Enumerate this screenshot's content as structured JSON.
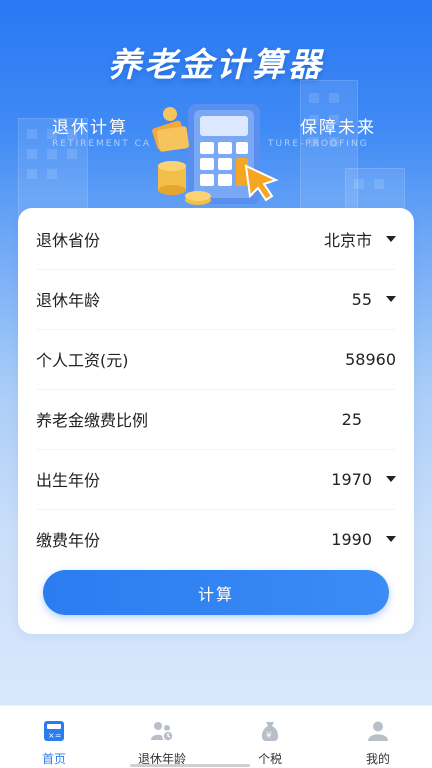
{
  "header": {
    "title": "养老金计算器",
    "sub_left": "退休计算",
    "sub_left_en": "RETIREMENT CA",
    "sub_right": "保障未来",
    "sub_right_en": "TURE-PROOFING"
  },
  "form": {
    "rows": [
      {
        "label": "退休省份",
        "value": "北京市",
        "dropdown": true
      },
      {
        "label": "退休年龄",
        "value": "55",
        "dropdown": true
      },
      {
        "label": "个人工资(元)",
        "value": "58960",
        "dropdown": false
      },
      {
        "label": "养老金缴费比例",
        "value": "25",
        "dropdown": false
      },
      {
        "label": "出生年份",
        "value": "1970",
        "dropdown": true
      },
      {
        "label": "缴费年份",
        "value": "1990",
        "dropdown": true
      }
    ],
    "submit_label": "计算"
  },
  "tabbar": {
    "items": [
      {
        "label": "首页",
        "icon": "calculator-icon",
        "active": true
      },
      {
        "label": "退休年龄",
        "icon": "people-icon",
        "active": false
      },
      {
        "label": "个税",
        "icon": "money-bag-icon",
        "active": false
      },
      {
        "label": "我的",
        "icon": "user-icon",
        "active": false
      }
    ]
  },
  "colors": {
    "accent": "#2b7cf0",
    "inactive_icon": "#b9bfc9"
  }
}
